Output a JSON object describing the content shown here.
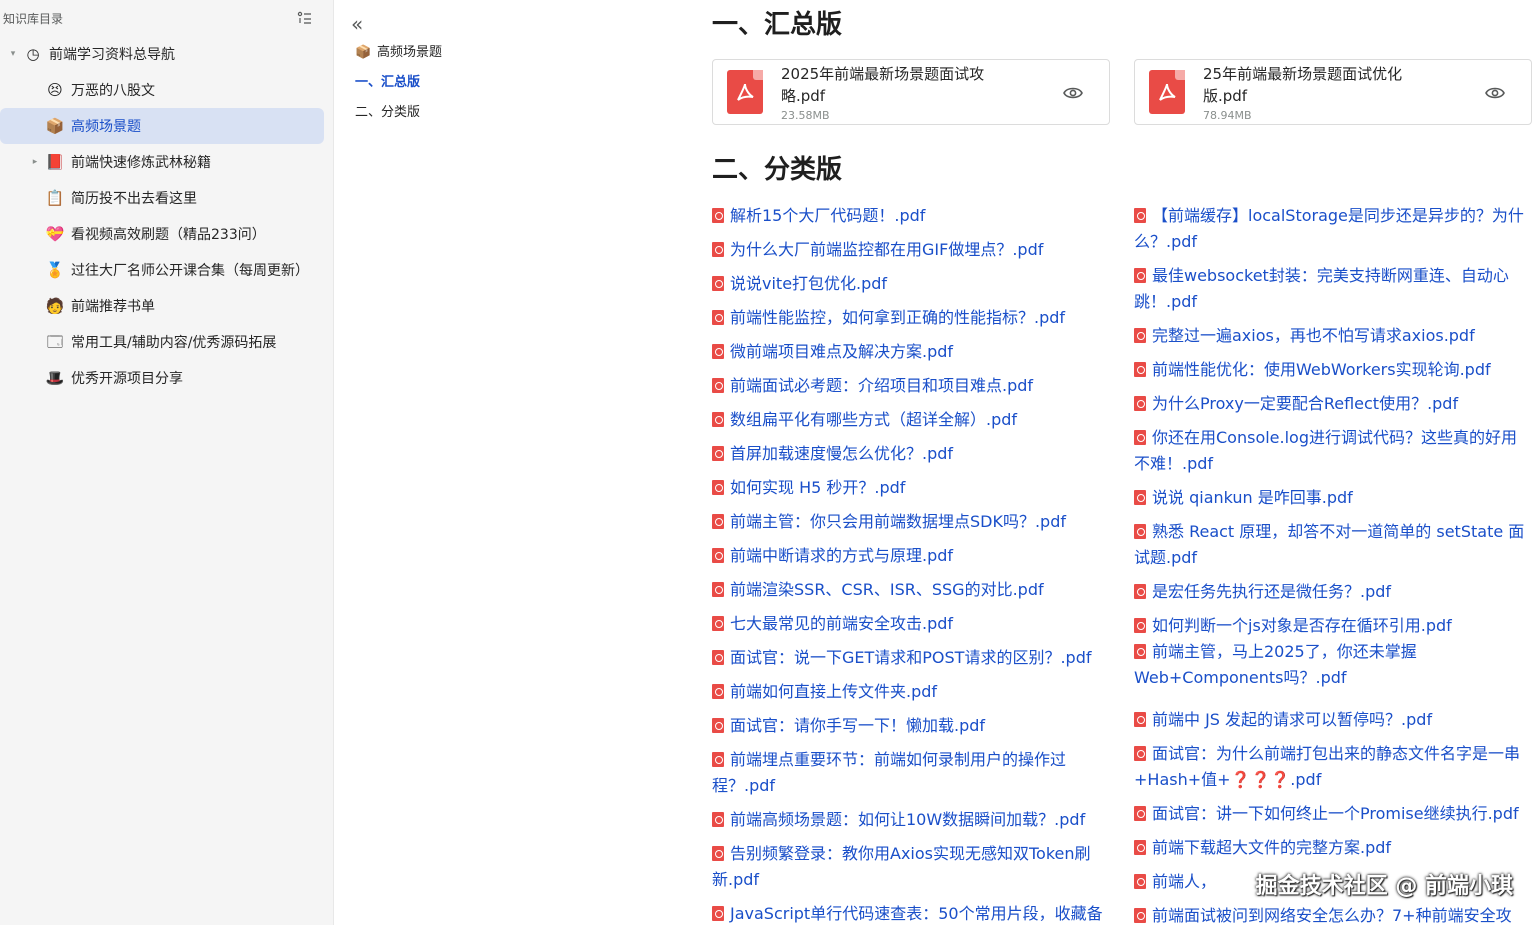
{
  "sidebar": {
    "header": "知识库目录",
    "items": [
      {
        "label": "前端学习资料总导航",
        "icon": "clock-icon",
        "glyph": "◷",
        "level": 0,
        "caret": "▾"
      },
      {
        "label": "万恶的八股文",
        "icon": "smiley-icon",
        "glyph": "😣",
        "level": 1,
        "caret": ""
      },
      {
        "label": "高频场景题",
        "icon": "cube-icon",
        "glyph": "📦",
        "level": 1,
        "caret": ""
      },
      {
        "label": "前端快速修炼武林秘籍",
        "icon": "book-icon",
        "glyph": "📕",
        "level": 1,
        "caret": "▸"
      },
      {
        "label": "简历投不出去看这里",
        "icon": "clipboard-icon",
        "glyph": "📋",
        "level": 1,
        "caret": ""
      },
      {
        "label": "看视频高效刷题（精品233问）",
        "icon": "heart-box-icon",
        "glyph": "💝",
        "level": 1,
        "caret": ""
      },
      {
        "label": "过往大厂名师公开课合集（每周更新）",
        "icon": "medal-icon",
        "glyph": "🏅",
        "level": 1,
        "caret": ""
      },
      {
        "label": "前端推荐书单",
        "icon": "reader-icon",
        "glyph": "🧑",
        "level": 1,
        "caret": ""
      },
      {
        "label": "常用工具/辅助内容/优秀源码拓展",
        "icon": "window-icon",
        "glyph": "🗔",
        "level": 1,
        "caret": ""
      },
      {
        "label": "优秀开源项目分享",
        "icon": "top-hat-icon",
        "glyph": "🎩",
        "level": 1,
        "caret": ""
      }
    ]
  },
  "outline": {
    "title": "高频场景题",
    "items": [
      "一、汇总版",
      "二、分类版"
    ]
  },
  "main": {
    "section1": "一、汇总版",
    "section2": "二、分类版",
    "cards": [
      {
        "name": "2025年前端最新场景题面试攻略.pdf",
        "size": "23.58MB"
      },
      {
        "name": "25年前端最新场景题面试优化版.pdf",
        "size": "78.94MB"
      }
    ],
    "left_files": [
      "解析15个大厂代码题！.pdf",
      "为什么大厂前端监控都在用GIF做埋点？.pdf",
      "说说vite打包优化.pdf",
      "前端性能监控，如何拿到正确的性能指标？.pdf",
      "微前端项目难点及解决方案.pdf",
      "前端面试必考题：介绍项目和项目难点.pdf",
      "数组扁平化有哪些方式（超详全解）.pdf",
      "首屏加载速度慢怎么优化？.pdf",
      "如何实现 H5 秒开？.pdf",
      "前端主管：你只会用前端数据埋点SDK吗？.pdf",
      "前端中断请求的方式与原理.pdf",
      "前端渲染SSR、CSR、ISR、SSG的对比.pdf",
      "七大最常见的前端安全攻击.pdf",
      "面试官：说一下GET请求和POST请求的区别？.pdf",
      "前端如何直接上传文件夹.pdf",
      "面试官：请你手写一下！懒加载.pdf",
      "前端埋点重要环节：前端如何录制用户的操作过程？.pdf",
      "前端高频场景题：如何让10W数据瞬间加载？.pdf",
      "告别频繁登录：教你用Axios实现无感知双Token刷新.pdf",
      "JavaScript单行代码速查表：50个常用片段，收藏备"
    ],
    "right_files": [
      "【前端缓存】localStorage是同步还是异步的？为什么？.pdf",
      "最佳websocket封装：完美支持断网重连、自动心跳！.pdf",
      "完整过一遍axios，再也不怕写请求axios.pdf",
      "前端性能优化：使用WebWorkers实现轮询.pdf",
      "为什么Proxy一定要配合Reflect使用？.pdf",
      "你还在用Console.log进行调试代码？这些真的好用不难！.pdf",
      "说说 qiankun 是咋回事.pdf",
      "熟悉 React 原理，却答不对一道简单的 setState 面试题.pdf",
      "是宏任务先执行还是微任务？.pdf",
      "如何判断一个js对象是否存在循环引用.pdf",
      "前端主管，马上2025了，你还未掌握Web+Components吗？.pdf",
      "前端中 JS 发起的请求可以暂停吗？.pdf",
      "面试官：为什么前端打包出来的静态文件名字是一串+Hash+值+❓❓❓.pdf",
      "面试官：讲一下如何终止一个Promise继续执行.pdf",
      "前端下载超大文件的完整方案.pdf",
      "前端人，",
      "前端面试被问到网络安全怎么办？7+种前端安全攻"
    ],
    "watermark": "掘金技术社区 @ 前端小琪"
  }
}
